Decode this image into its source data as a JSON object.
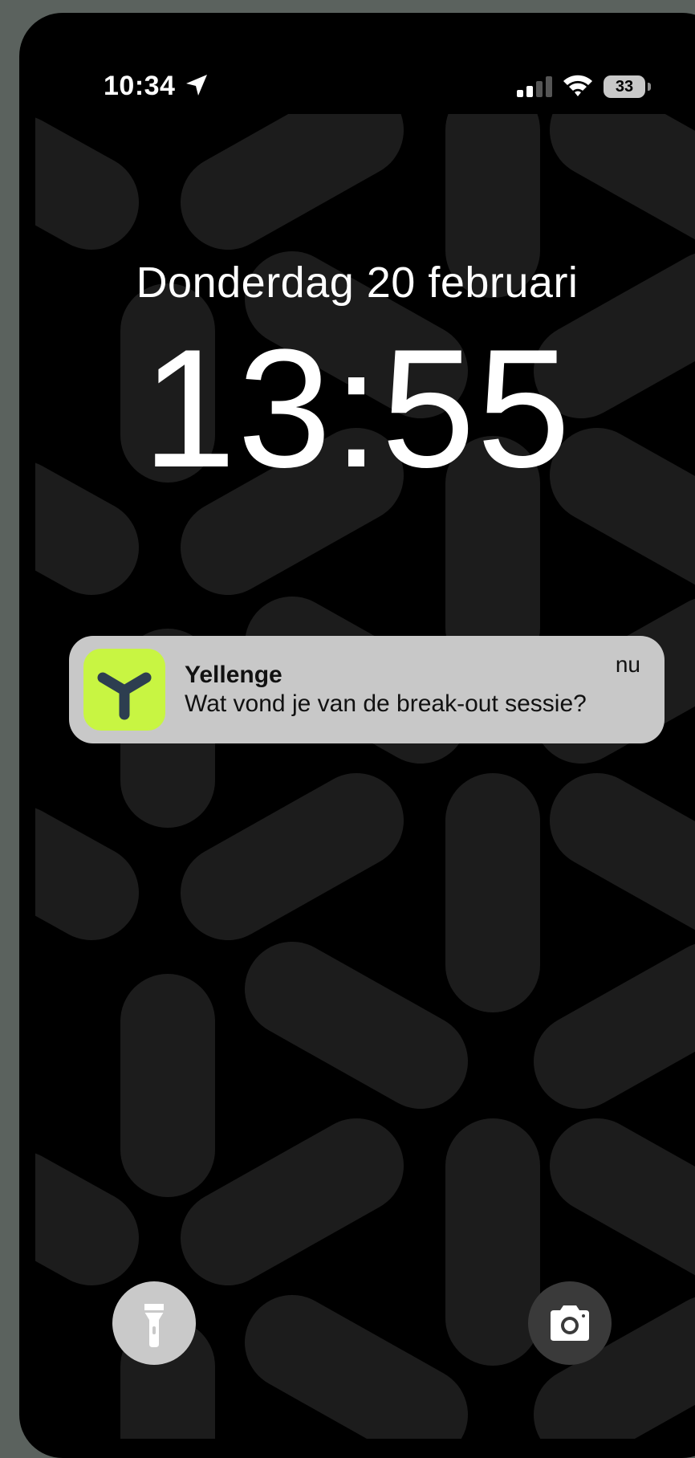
{
  "status_bar": {
    "time": "10:34",
    "location_icon": "location-arrow-icon",
    "signal_icon": "cellular-signal-icon",
    "wifi_icon": "wifi-icon",
    "battery_level": "33"
  },
  "lock_screen": {
    "date": "Donderdag 20 februari",
    "time": "13:55"
  },
  "notification": {
    "app_name": "Yellenge",
    "message": "Wat vond je van de break-out sessie?",
    "timestamp": "nu",
    "app_icon": "yellenge-logo-icon",
    "app_icon_color": "#c8f542",
    "logo_color": "#2d3e50"
  },
  "quick_actions": {
    "left": "flashlight-icon",
    "right": "camera-icon"
  },
  "colors": {
    "background": "#000000",
    "pattern": "#1c1c1c",
    "notification_bg": "#c8c8c8"
  }
}
